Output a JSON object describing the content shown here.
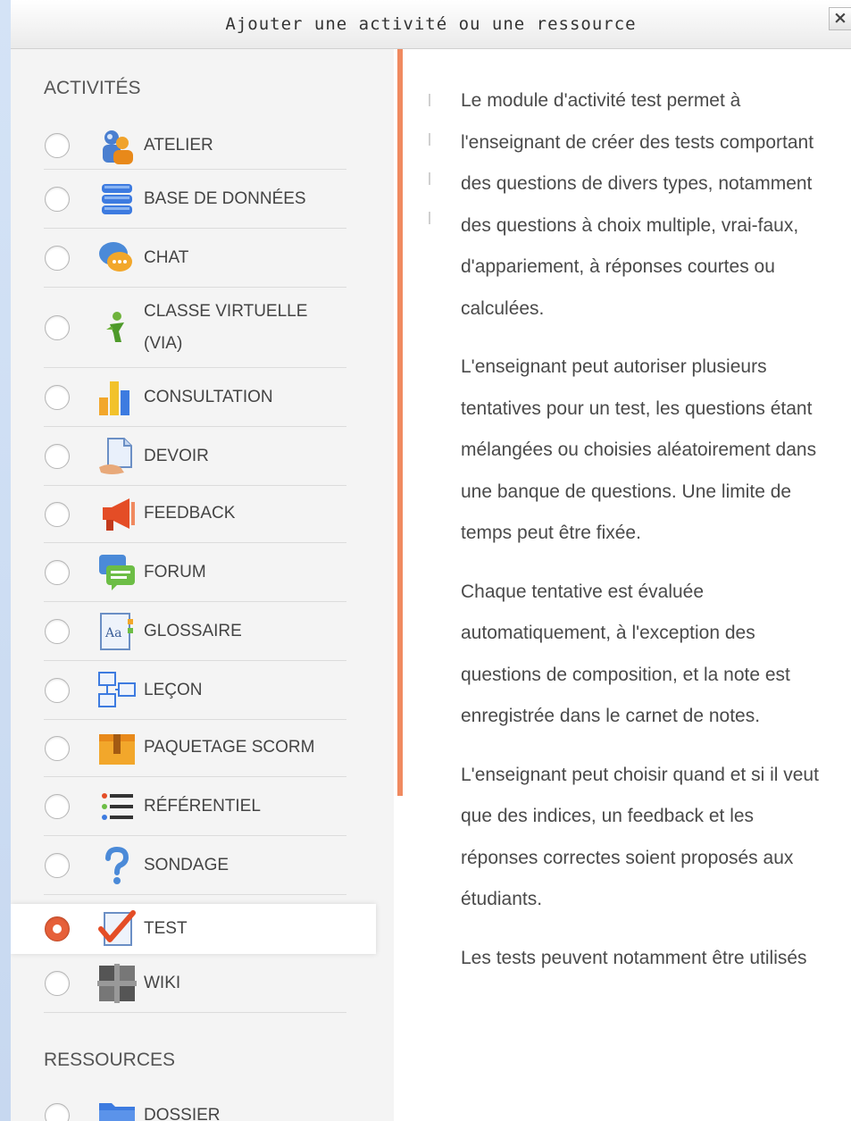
{
  "dialog": {
    "title": "Ajouter une activité ou une ressource",
    "close_label": "×"
  },
  "sections": {
    "activities_header": "ACTIVITÉS",
    "resources_header": "RESSOURCES"
  },
  "activities": [
    {
      "label": "ATELIER",
      "icon": "workshop-icon",
      "selected": false
    },
    {
      "label": "BASE DE DONNÉES",
      "icon": "database-icon",
      "selected": false
    },
    {
      "label": "CHAT",
      "icon": "chat-icon",
      "selected": false
    },
    {
      "label": "CLASSE VIRTUELLE (VIA)",
      "icon": "virtual-class-icon",
      "selected": false
    },
    {
      "label": "CONSULTATION",
      "icon": "bar-chart-icon",
      "selected": false
    },
    {
      "label": "DEVOIR",
      "icon": "assignment-icon",
      "selected": false
    },
    {
      "label": "FEEDBACK",
      "icon": "megaphone-icon",
      "selected": false
    },
    {
      "label": "FORUM",
      "icon": "forum-icon",
      "selected": false
    },
    {
      "label": "GLOSSAIRE",
      "icon": "glossary-icon",
      "selected": false
    },
    {
      "label": "LEÇON",
      "icon": "lesson-icon",
      "selected": false
    },
    {
      "label": "PAQUETAGE SCORM",
      "icon": "package-icon",
      "selected": false
    },
    {
      "label": "RÉFÉRENTIEL",
      "icon": "list-icon",
      "selected": false
    },
    {
      "label": "SONDAGE",
      "icon": "question-icon",
      "selected": false
    },
    {
      "label": "TEST",
      "icon": "checkmark-icon",
      "selected": true
    },
    {
      "label": "WIKI",
      "icon": "wiki-icon",
      "selected": false
    }
  ],
  "resources": [
    {
      "label": "DOSSIER",
      "icon": "folder-icon",
      "selected": false
    }
  ],
  "help": {
    "paragraphs": [
      "Le module d'activité test permet à l'enseignant de créer des tests comportant des questions de divers types, notamment des questions à choix multiple, vrai-faux, d'appariement, à réponses courtes ou calculées.",
      "L'enseignant peut autoriser plusieurs tentatives pour un test, les questions étant mélangées ou choisies aléatoirement dans une banque de questions. Une limite de temps peut être fixée.",
      "Chaque tentative est évaluée automatiquement, à l'exception des questions de composition, et la note est enregistrée dans le carnet de notes.",
      "L'enseignant peut choisir quand et si il veut que des indices, un feedback et les réponses correctes soient proposés aux étudiants.",
      "Les tests peuvent notamment être utilisés"
    ]
  },
  "colors": {
    "accent": "#e6603a",
    "scrollbar": "#f08a60"
  }
}
